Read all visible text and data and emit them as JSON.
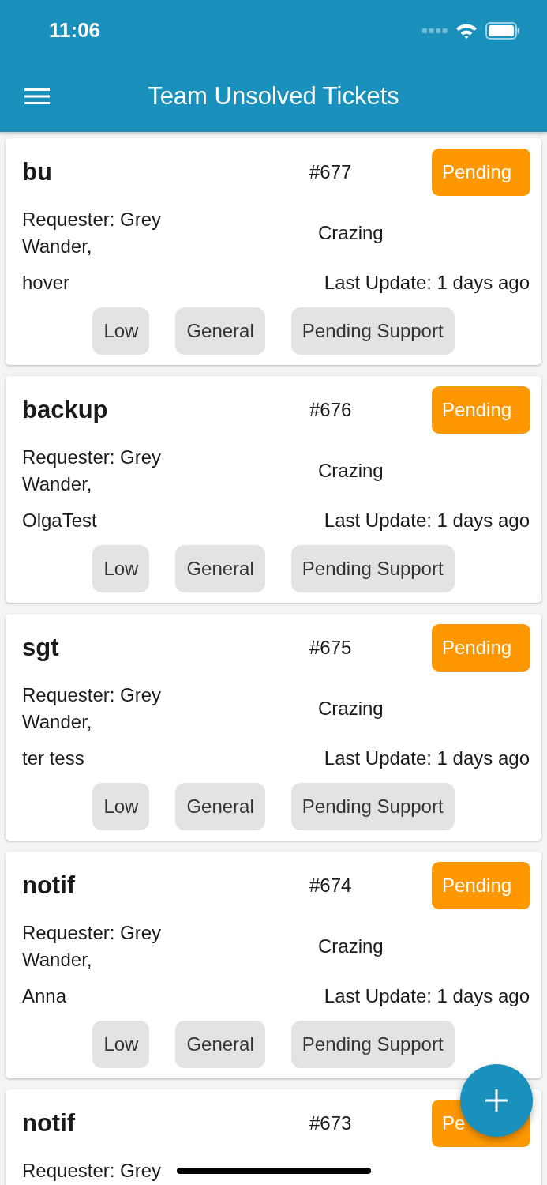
{
  "status_bar": {
    "time": "11:06"
  },
  "header": {
    "title": "Team Unsolved Tickets"
  },
  "tickets": [
    {
      "title": "bu",
      "number": "#677",
      "status": "Pending",
      "requester": "Requester: Grey Wander,",
      "category": "Crazing",
      "note": "hover",
      "last_update": "Last Update: 1 days ago",
      "tags": [
        "Low",
        "General",
        "Pending Support"
      ]
    },
    {
      "title": "backup",
      "number": "#676",
      "status": "Pending",
      "requester": "Requester: Grey Wander,",
      "category": "Crazing",
      "note": "OlgaTest",
      "last_update": "Last Update: 1 days ago",
      "tags": [
        "Low",
        "General",
        "Pending Support"
      ]
    },
    {
      "title": "sgt",
      "number": "#675",
      "status": "Pending",
      "requester": "Requester: Grey Wander,",
      "category": "Crazing",
      "note": "ter tess",
      "last_update": "Last Update: 1 days ago",
      "tags": [
        "Low",
        "General",
        "Pending Support"
      ]
    },
    {
      "title": "notif",
      "number": "#674",
      "status": "Pending",
      "requester": "Requester: Grey Wander,",
      "category": "Crazing",
      "note": "Anna",
      "last_update": "Last Update: 1 days ago",
      "tags": [
        "Low",
        "General",
        "Pending Support"
      ]
    },
    {
      "title": "notif",
      "number": "#673",
      "status": "Pe",
      "requester": "Requester: Grey"
    }
  ]
}
